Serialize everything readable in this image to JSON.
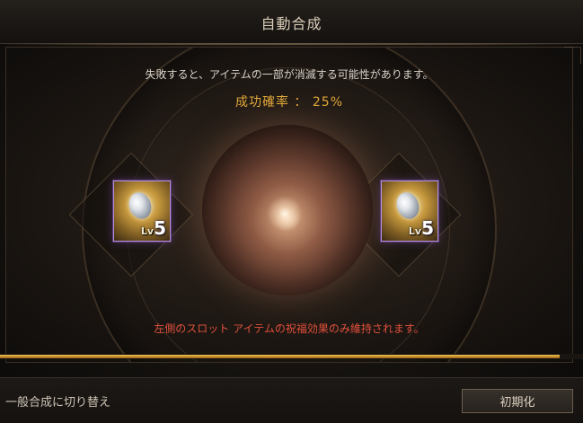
{
  "window": {
    "title": "自動合成"
  },
  "synthesis": {
    "description": "失敗すると、アイテムの一部が消滅する可能性があります。",
    "success_rate": "成功確率 ： 25%",
    "note": "左側のスロット アイテムの祝福効果のみ維持されます。"
  },
  "slots": [
    {
      "lv_prefix": "Lv",
      "level": "5"
    },
    {
      "lv_prefix": "Lv",
      "level": "5"
    }
  ],
  "progress": {
    "fraction": 0.96
  },
  "footer": {
    "switch_label": "一般合成に切り替え",
    "reset_label": "初期化"
  },
  "colors": {
    "rate": "#e0a83a",
    "note": "#e0503c",
    "slot_border": "#b58fd6",
    "progress": "#c48b26"
  },
  "icons": {
    "slot_item": "stone-item-icon",
    "center": "synthesis-orb-icon"
  }
}
